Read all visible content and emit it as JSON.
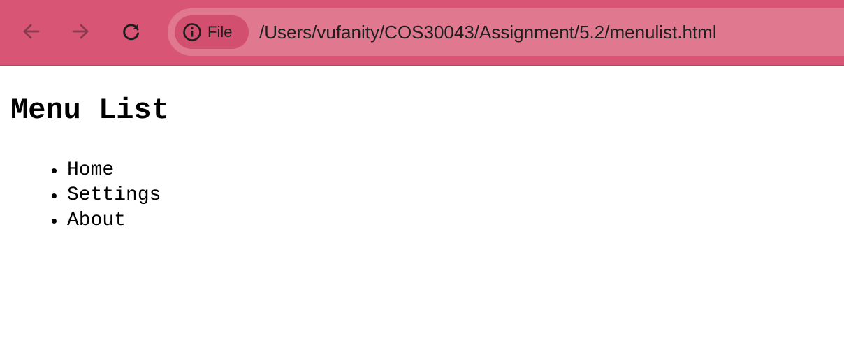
{
  "browser": {
    "nav": {
      "back_icon": "arrow-left-icon",
      "forward_icon": "arrow-right-icon",
      "reload_icon": "reload-icon"
    },
    "address_bar": {
      "chip_label": "File",
      "chip_icon": "info-icon",
      "url": "/Users/vufanity/COS30043/Assignment/5.2/menulist.html"
    },
    "colors": {
      "toolbar": "#d85575",
      "omnibox": "#e07890",
      "chip": "#d24f6f"
    }
  },
  "page": {
    "heading": "Menu List",
    "menu_items": [
      {
        "label": "Home"
      },
      {
        "label": "Settings"
      },
      {
        "label": "About"
      }
    ]
  }
}
